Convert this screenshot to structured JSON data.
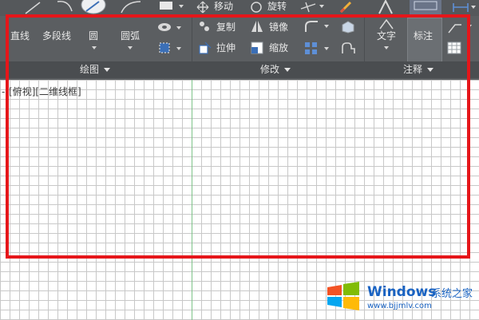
{
  "toolbar_top": {
    "move_label": "移动",
    "rotate_label": "旋转"
  },
  "draw_panel": {
    "title": "绘图",
    "line_label": "直线",
    "polyline_label": "多段线",
    "circle_label": "圆",
    "arc_label": "圆弧"
  },
  "modify_panel": {
    "title": "修改",
    "copy_label": "复制",
    "mirror_label": "镜像",
    "stretch_label": "拉伸",
    "scale_label": "缩放"
  },
  "annotation_panel": {
    "title": "注释",
    "text_label": "文字",
    "dimension_label": "标注"
  },
  "viewport": {
    "label": "-][俯视][二维线框]"
  },
  "watermark": {
    "brand": "Windows",
    "brand_cn": "系统之家",
    "url": "www.bjjmlv.com"
  },
  "colors": {
    "ribbon_bg": "#5b5e61",
    "highlight_border": "#e5161a",
    "grid_line": "#c8c8c8",
    "y_axis": "#7fc48a",
    "watermark_blue": "#1a63c2"
  }
}
